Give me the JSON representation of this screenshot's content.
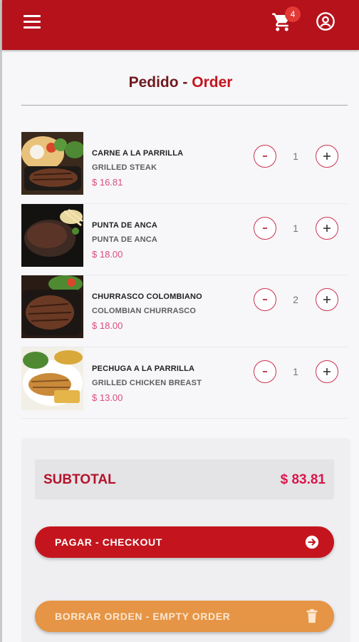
{
  "header": {
    "cart_count": "4",
    "brand_color": "#b5121b"
  },
  "page": {
    "title_main": "Pedido - ",
    "title_accent": "Order"
  },
  "order_items": [
    {
      "name": "CARNE A LA PARRILLA",
      "subtitle": "GRILLED STEAK",
      "price": "$ 16.81",
      "quantity": "1",
      "image": "grilled-steak-photo"
    },
    {
      "name": "PUNTA DE ANCA",
      "subtitle": "PUNTA DE ANCA",
      "price": "$ 18.00",
      "quantity": "1",
      "image": "punta-de-anca-photo"
    },
    {
      "name": "CHURRASCO COLOMBIANO",
      "subtitle": "COLOMBIAN CHURRASCO",
      "price": "$ 18.00",
      "quantity": "2",
      "image": "churrasco-photo"
    },
    {
      "name": "PECHUGA A LA PARRILLA",
      "subtitle": "GRILLED CHICKEN BREAST",
      "price": "$ 13.00",
      "quantity": "1",
      "image": "grilled-chicken-photo"
    }
  ],
  "summary": {
    "subtotal_label": "SUBTOTAL",
    "subtotal_value": "$ 83.81"
  },
  "actions": {
    "checkout_label": "PAGAR - CHECKOUT",
    "empty_label": "BORRAR ORDEN - EMPTY ORDER"
  },
  "colors": {
    "accent": "#c4151e",
    "price": "#d84f7b",
    "empty_button": "#e59545"
  }
}
